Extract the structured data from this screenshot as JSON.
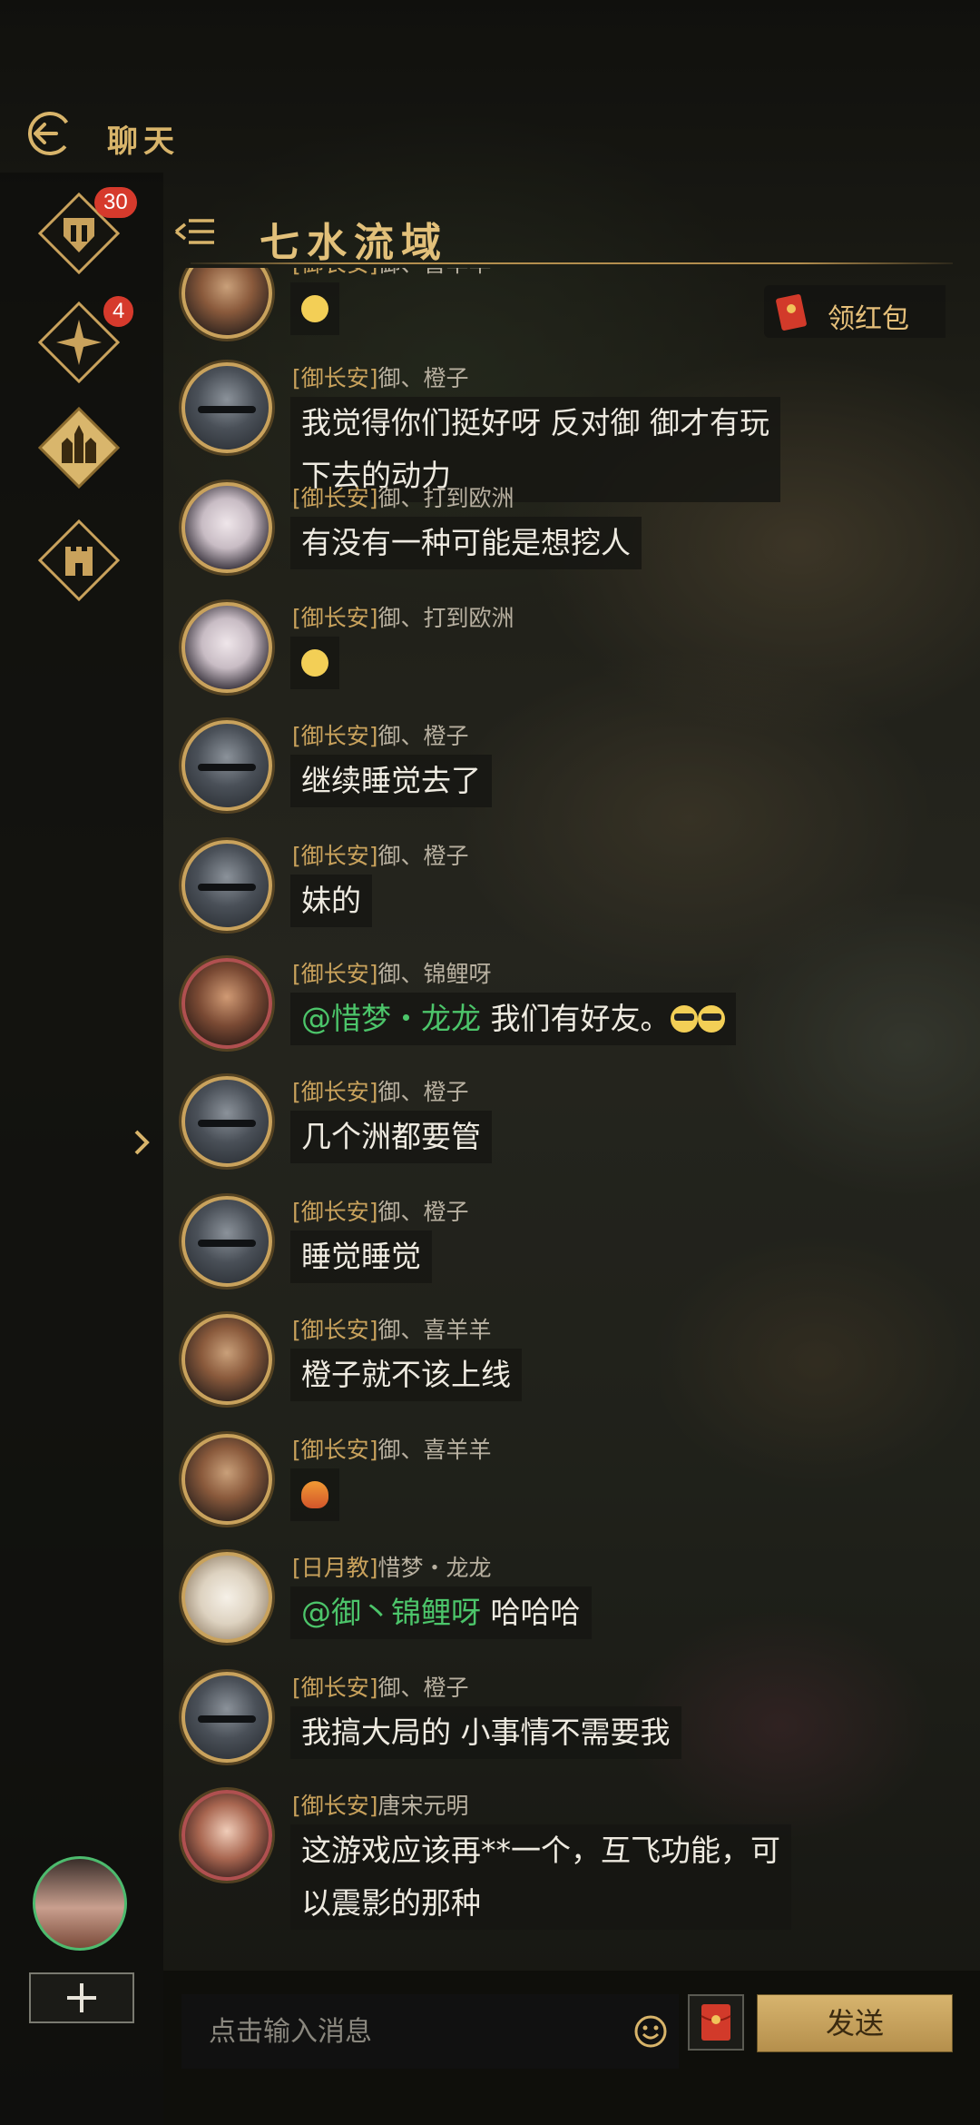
{
  "header": {
    "title": "聊天",
    "back_icon": "back-arrow-icon"
  },
  "rail": {
    "items": [
      {
        "name": "guild-chat",
        "icon": "helmet-emblem-icon",
        "badge": "30"
      },
      {
        "name": "world-chat",
        "icon": "compass-emblem-icon",
        "badge": "4"
      },
      {
        "name": "city-chat",
        "icon": "castle-emblem-icon",
        "badge": ""
      },
      {
        "name": "alliance-chat",
        "icon": "tower-emblem-icon",
        "badge": ""
      }
    ]
  },
  "channel": {
    "title": "七水流域"
  },
  "red_packet": {
    "label": "领红包"
  },
  "messages": [
    {
      "tag": "[御长安]",
      "sender": "御、喜羊羊",
      "text": "",
      "emoji": "smile"
    },
    {
      "tag": "[御长安]",
      "sender": "御、橙子",
      "text": "我觉得你们挺好呀  反对御  御才有玩",
      "text2": "下去的动力"
    },
    {
      "tag": "[御长安]",
      "sender": "御、打到欧洲",
      "text": "有没有一种可能是想挖人"
    },
    {
      "tag": "[御长安]",
      "sender": "御、打到欧洲",
      "text": "",
      "emoji": "smile"
    },
    {
      "tag": "[御长安]",
      "sender": "御、橙子",
      "text": "继续睡觉去了"
    },
    {
      "tag": "[御长安]",
      "sender": "御、橙子",
      "text": "妹的"
    },
    {
      "tag": "[御长安]",
      "sender": "御、锦鲤呀",
      "mention": "@惜梦・龙龙",
      "text": " 我们有好友。",
      "emoji": "cool"
    },
    {
      "tag": "[御长安]",
      "sender": "御、橙子",
      "text": "几个洲都要管"
    },
    {
      "tag": "[御长安]",
      "sender": "御、橙子",
      "text": "睡觉睡觉"
    },
    {
      "tag": "[御长安]",
      "sender": "御、喜羊羊",
      "text": "橙子就不该上线"
    },
    {
      "tag": "[御长安]",
      "sender": "御、喜羊羊",
      "text": "",
      "emoji": "fire"
    },
    {
      "tag": "[日月教]",
      "sender": "惜梦・龙龙",
      "mention": "@御丶锦鲤呀",
      "text": " 哈哈哈"
    },
    {
      "tag": "[御长安]",
      "sender": "御、橙子",
      "text": "我搞大局的 小事情不需要我"
    },
    {
      "tag": "[御长安]",
      "sender": "唐宋元明",
      "text": "这游戏应该再**一个，互飞功能，可",
      "text2": "以震影的那种"
    }
  ],
  "input": {
    "placeholder": "点击输入消息",
    "send_label": "发送"
  },
  "colors": {
    "accent": "#d8b46a",
    "mention": "#4cc56a",
    "badge": "#d63a2c"
  }
}
